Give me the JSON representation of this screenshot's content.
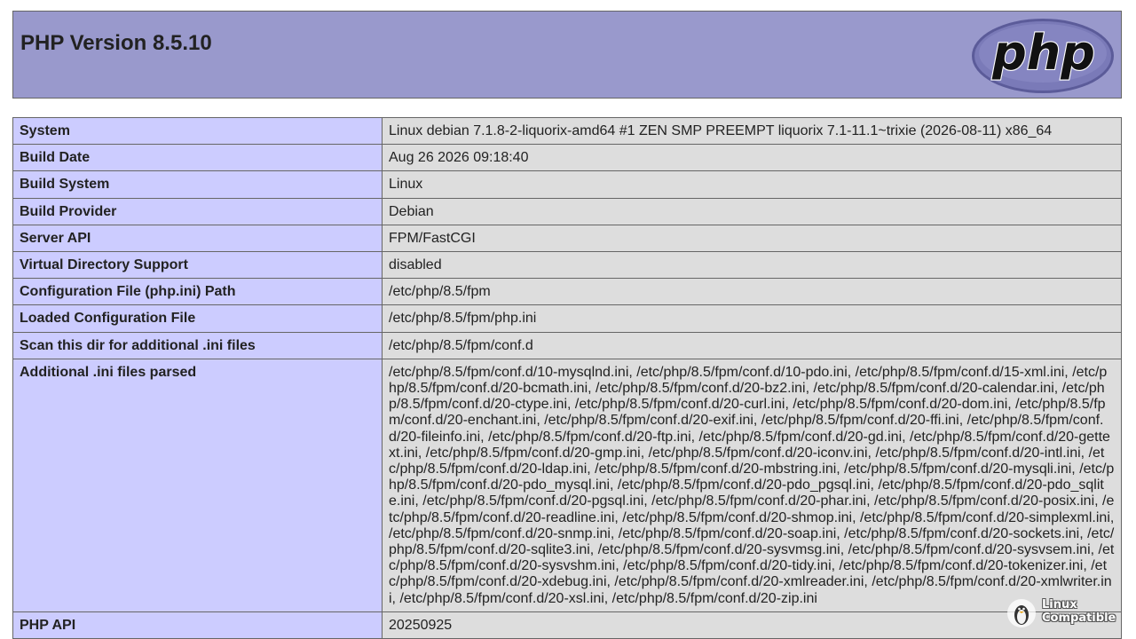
{
  "header": {
    "title": "PHP Version 8.5.10",
    "logo_text": "php"
  },
  "rows": [
    {
      "label": "System",
      "value": "Linux debian 7.1.8-2-liquorix-amd64 #1 ZEN SMP PREEMPT liquorix 7.1-11.1~trixie (2026-08-11) x86_64"
    },
    {
      "label": "Build Date",
      "value": "Aug 26 2026 09:18:40"
    },
    {
      "label": "Build System",
      "value": "Linux"
    },
    {
      "label": "Build Provider",
      "value": "Debian"
    },
    {
      "label": "Server API",
      "value": "FPM/FastCGI"
    },
    {
      "label": "Virtual Directory Support",
      "value": "disabled"
    },
    {
      "label": "Configuration File (php.ini) Path",
      "value": "/etc/php/8.5/fpm"
    },
    {
      "label": "Loaded Configuration File",
      "value": "/etc/php/8.5/fpm/php.ini"
    },
    {
      "label": "Scan this dir for additional .ini files",
      "value": "/etc/php/8.5/fpm/conf.d"
    },
    {
      "label": "Additional .ini files parsed",
      "value": "/etc/php/8.5/fpm/conf.d/10-mysqlnd.ini, /etc/php/8.5/fpm/conf.d/10-pdo.ini, /etc/php/8.5/fpm/conf.d/15-xml.ini, /etc/php/8.5/fpm/conf.d/20-bcmath.ini, /etc/php/8.5/fpm/conf.d/20-bz2.ini, /etc/php/8.5/fpm/conf.d/20-calendar.ini, /etc/php/8.5/fpm/conf.d/20-ctype.ini, /etc/php/8.5/fpm/conf.d/20-curl.ini, /etc/php/8.5/fpm/conf.d/20-dom.ini, /etc/php/8.5/fpm/conf.d/20-enchant.ini, /etc/php/8.5/fpm/conf.d/20-exif.ini, /etc/php/8.5/fpm/conf.d/20-ffi.ini, /etc/php/8.5/fpm/conf.d/20-fileinfo.ini, /etc/php/8.5/fpm/conf.d/20-ftp.ini, /etc/php/8.5/fpm/conf.d/20-gd.ini, /etc/php/8.5/fpm/conf.d/20-gettext.ini, /etc/php/8.5/fpm/conf.d/20-gmp.ini, /etc/php/8.5/fpm/conf.d/20-iconv.ini, /etc/php/8.5/fpm/conf.d/20-intl.ini, /etc/php/8.5/fpm/conf.d/20-ldap.ini, /etc/php/8.5/fpm/conf.d/20-mbstring.ini, /etc/php/8.5/fpm/conf.d/20-mysqli.ini, /etc/php/8.5/fpm/conf.d/20-pdo_mysql.ini, /etc/php/8.5/fpm/conf.d/20-pdo_pgsql.ini, /etc/php/8.5/fpm/conf.d/20-pdo_sqlite.ini, /etc/php/8.5/fpm/conf.d/20-pgsql.ini, /etc/php/8.5/fpm/conf.d/20-phar.ini, /etc/php/8.5/fpm/conf.d/20-posix.ini, /etc/php/8.5/fpm/conf.d/20-readline.ini, /etc/php/8.5/fpm/conf.d/20-shmop.ini, /etc/php/8.5/fpm/conf.d/20-simplexml.ini, /etc/php/8.5/fpm/conf.d/20-snmp.ini, /etc/php/8.5/fpm/conf.d/20-soap.ini, /etc/php/8.5/fpm/conf.d/20-sockets.ini, /etc/php/8.5/fpm/conf.d/20-sqlite3.ini, /etc/php/8.5/fpm/conf.d/20-sysvmsg.ini, /etc/php/8.5/fpm/conf.d/20-sysvsem.ini, /etc/php/8.5/fpm/conf.d/20-sysvshm.ini, /etc/php/8.5/fpm/conf.d/20-tidy.ini, /etc/php/8.5/fpm/conf.d/20-tokenizer.ini, /etc/php/8.5/fpm/conf.d/20-xdebug.ini, /etc/php/8.5/fpm/conf.d/20-xmlreader.ini, /etc/php/8.5/fpm/conf.d/20-xmlwriter.ini, /etc/php/8.5/fpm/conf.d/20-xsl.ini, /etc/php/8.5/fpm/conf.d/20-zip.ini"
    },
    {
      "label": "PHP API",
      "value": "20250925"
    }
  ],
  "watermark": {
    "line1": "Linux",
    "line2": "Compatible"
  },
  "colors": {
    "header_bg": "#9999cc",
    "label_bg": "#ccccff",
    "value_bg": "#dddddd",
    "border": "#666666"
  }
}
